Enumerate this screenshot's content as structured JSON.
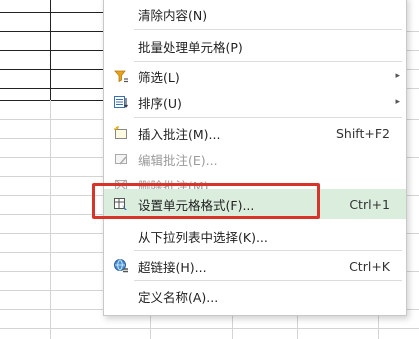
{
  "menu": {
    "items": [
      {
        "label": "清除内容(N)"
      },
      {
        "label": "批量处理单元格(P)"
      },
      {
        "label": "筛选(L)"
      },
      {
        "label": "排序(U)"
      },
      {
        "label": "插入批注(M)...",
        "shortcut": "Shift+F2"
      },
      {
        "label": "编辑批注(E)..."
      },
      {
        "label": "删除批注(M)"
      },
      {
        "label": "设置单元格格式(F)...",
        "shortcut": "Ctrl+1"
      },
      {
        "label": "从下拉列表中选择(K)..."
      },
      {
        "label": "超链接(H)...",
        "shortcut": "Ctrl+K"
      },
      {
        "label": "定义名称(A)..."
      }
    ],
    "submenu_arrow": "▸"
  },
  "icons": {
    "filter": "filter-icon",
    "sort": "sort-icon",
    "insert_comment": "insert-comment-icon",
    "edit_comment": "edit-comment-icon",
    "delete_comment": "delete-comment-icon",
    "format_cells": "format-cells-icon",
    "hyperlink": "hyperlink-icon"
  },
  "colors": {
    "highlight": "#dbeedd",
    "annotation": "#d9342a",
    "grid": "#d4d4d4"
  }
}
